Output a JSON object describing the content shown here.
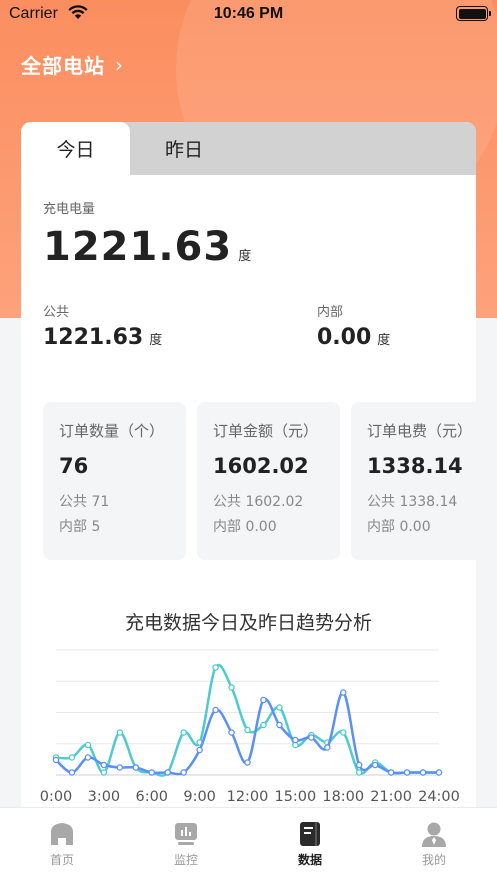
{
  "status_bar": {
    "carrier": "Carrier",
    "time": "10:46 PM"
  },
  "header": {
    "station": "全部电站",
    "chevron": "›"
  },
  "tabs": [
    {
      "label": "今日",
      "active": true
    },
    {
      "label": "昨日",
      "active": false
    }
  ],
  "charge": {
    "label": "充电电量",
    "value": "1221.63",
    "unit": "度",
    "public": {
      "label": "公共",
      "value": "1221.63",
      "unit": "度"
    },
    "internal": {
      "label": "内部",
      "value": "0.00",
      "unit": "度"
    }
  },
  "stats": [
    {
      "title": "订单数量（个）",
      "value": "76",
      "public": "公共 71",
      "internal": "内部 5"
    },
    {
      "title": "订单金额（元）",
      "value": "1602.02",
      "public": "公共 1602.02",
      "internal": "内部 0.00"
    },
    {
      "title": "订单电费（元）",
      "value": "1338.14",
      "public": "公共 1338.14",
      "internal": "内部 0.00"
    }
  ],
  "chart_data": {
    "type": "line",
    "title": "充电数据今日及昨日趋势分析",
    "x_ticks": [
      "0:00",
      "3:00",
      "6:00",
      "9:00",
      "12:00",
      "15:00",
      "18:00",
      "21:00",
      "24:00"
    ],
    "x": [
      0,
      1,
      2,
      3,
      4,
      5,
      6,
      7,
      8,
      9,
      10,
      11,
      12,
      13,
      14,
      15,
      16,
      17,
      18,
      19,
      20,
      21,
      22,
      23,
      24
    ],
    "xlim": [
      0,
      24
    ],
    "ylim": [
      0,
      100
    ],
    "grid": true,
    "colors": {
      "today": "#5b8ff9",
      "yesterday": "#4ecbcf"
    },
    "series": [
      {
        "values": [
          12,
          2,
          14,
          8,
          6,
          6,
          2,
          2,
          2,
          20,
          52,
          34,
          10,
          60,
          40,
          28,
          30,
          22,
          66,
          8,
          8,
          2,
          2,
          2,
          2
        ],
        "color": "#5b8ff9"
      },
      {
        "values": [
          14,
          14,
          24,
          2,
          34,
          6,
          2,
          2,
          34,
          26,
          86,
          70,
          36,
          40,
          54,
          24,
          32,
          26,
          34,
          2,
          10,
          2,
          2,
          2,
          2
        ],
        "color": "#4ecbcf"
      }
    ]
  },
  "tabbar": [
    {
      "label": "首页",
      "icon": "home-icon",
      "active": false
    },
    {
      "label": "监控",
      "icon": "monitor-icon",
      "active": false
    },
    {
      "label": "数据",
      "icon": "data-book-icon",
      "active": true
    },
    {
      "label": "我的",
      "icon": "user-icon",
      "active": false
    }
  ]
}
